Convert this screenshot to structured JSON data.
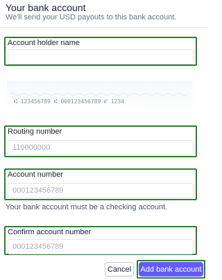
{
  "header": {
    "title": "Your bank account",
    "subtitle": "We'll send your USD payouts to this bank account."
  },
  "fields": {
    "account_holder": {
      "label": "Account holder name",
      "value": "",
      "placeholder": ""
    },
    "routing": {
      "label": "Routing number",
      "value": "",
      "placeholder": "110000000"
    },
    "account": {
      "label": "Account number",
      "value": "",
      "placeholder": "000123456789"
    },
    "confirm": {
      "label": "Confirm account number",
      "value": "",
      "placeholder": "000123456789"
    }
  },
  "check_example": {
    "routing_number": "123456789",
    "account_number": "000123456789",
    "check_number": "1234"
  },
  "note": "Your bank account must be a checking account.",
  "actions": {
    "cancel_label": "Cancel",
    "submit_label": "Add bank account"
  },
  "colors": {
    "accent": "#635bff",
    "highlight": "#2e7d32",
    "text": "#1a1f36"
  }
}
